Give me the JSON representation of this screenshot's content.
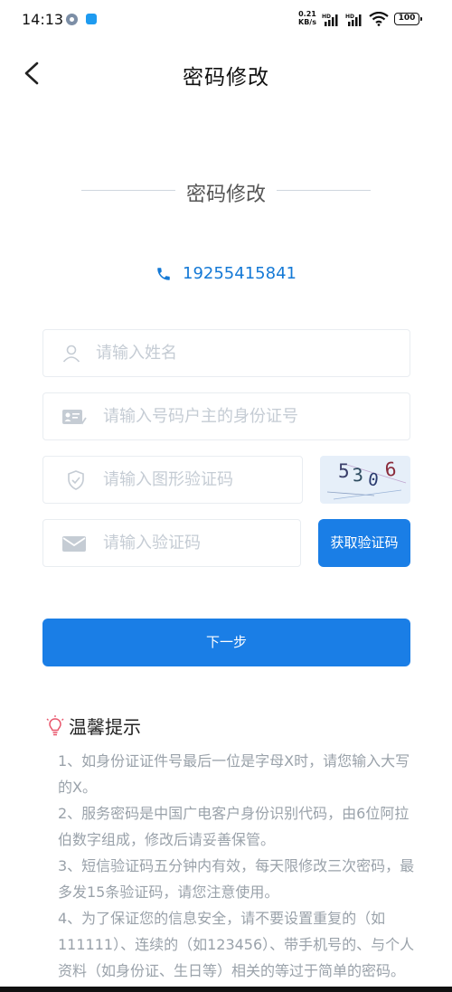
{
  "status_bar": {
    "time": "14:13",
    "net_speed_value": "0.21",
    "net_speed_unit": "KB/s",
    "battery": "100",
    "signal_label": "HD"
  },
  "nav": {
    "title": "密码修改"
  },
  "section": {
    "heading": "密码修改"
  },
  "phone": {
    "number": "19255415841"
  },
  "form": {
    "name_placeholder": "请输入姓名",
    "id_placeholder": "请输入号码户主的身份证号",
    "captcha_placeholder": "请输入图形验证码",
    "sms_placeholder": "请输入验证码",
    "captcha_digits": [
      "5",
      "3",
      "0",
      "6"
    ],
    "get_code_label": "获取验证码"
  },
  "next_button": "下一步",
  "tips": {
    "title": "温馨提示",
    "items": [
      "1、如身份证证件号最后一位是字母X时，请您输入大写的X。",
      "2、服务密码是中国广电客户身份识别代码，由6位阿拉伯数字组成，修改后请妥善保管。",
      "3、短信验证码五分钟内有效，每天限修改三次密码，最多发15条验证码，请您注意使用。",
      "4、为了保证您的信息安全，请不要设置重复的（如111111）、连续的（如123456）、带手机号的、与个人资料（如身份证、生日等）相关的等过于简单的密码。"
    ]
  },
  "colors": {
    "accent": "#1a7ee6",
    "phone_text": "#1479d6",
    "placeholder": "#c5ccd4",
    "tip_text": "#9aa2aa"
  }
}
